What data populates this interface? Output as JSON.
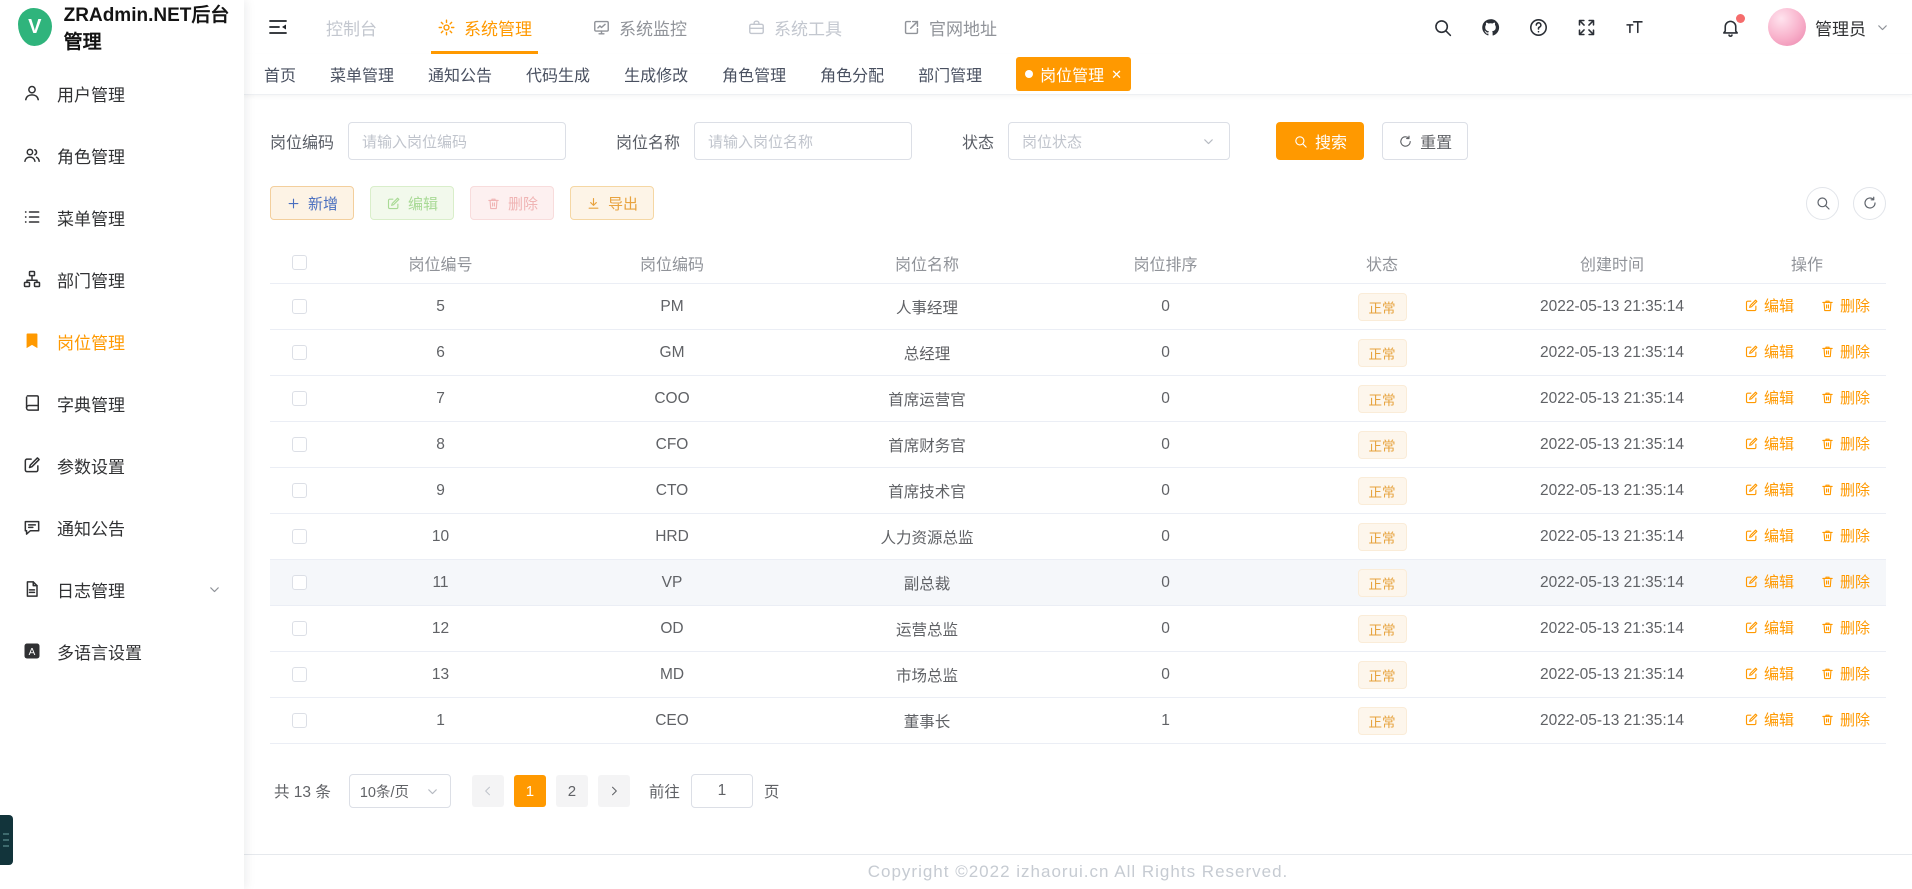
{
  "app": {
    "title": "ZRAdmin.NET后台管理",
    "logo_letter": "V"
  },
  "sidebar": {
    "items": [
      {
        "key": "user",
        "label": "用户管理",
        "icon": "user-icon"
      },
      {
        "key": "role",
        "label": "角色管理",
        "icon": "roles-icon"
      },
      {
        "key": "menu",
        "label": "菜单管理",
        "icon": "menu-list-icon"
      },
      {
        "key": "dept",
        "label": "部门管理",
        "icon": "org-tree-icon"
      },
      {
        "key": "post",
        "label": "岗位管理",
        "icon": "post-badge-icon",
        "active": true
      },
      {
        "key": "dict",
        "label": "字典管理",
        "icon": "dictionary-icon"
      },
      {
        "key": "param",
        "label": "参数设置",
        "icon": "edit-square-icon"
      },
      {
        "key": "notice",
        "label": "通知公告",
        "icon": "message-icon"
      },
      {
        "key": "log",
        "label": "日志管理",
        "icon": "document-icon",
        "arrow": true
      },
      {
        "key": "i18n",
        "label": "多语言设置",
        "icon": "language-icon"
      }
    ]
  },
  "topnav": {
    "items": [
      {
        "key": "console",
        "label": "控制台",
        "muted": true
      },
      {
        "key": "sysmanage",
        "label": "系统管理",
        "icon": "gear-icon",
        "active": true
      },
      {
        "key": "sysmonitor",
        "label": "系统监控",
        "icon": "monitor-icon"
      },
      {
        "key": "systools",
        "label": "系统工具",
        "icon": "toolbox-icon",
        "muted": true
      },
      {
        "key": "website",
        "label": "官网地址",
        "icon": "external-link-icon"
      }
    ],
    "user": {
      "name": "管理员"
    }
  },
  "tabs": {
    "items": [
      {
        "key": "home",
        "label": "首页"
      },
      {
        "key": "menu",
        "label": "菜单管理"
      },
      {
        "key": "notice",
        "label": "通知公告"
      },
      {
        "key": "codegen",
        "label": "代码生成"
      },
      {
        "key": "genedit",
        "label": "生成修改"
      },
      {
        "key": "role",
        "label": "角色管理"
      },
      {
        "key": "roleassign",
        "label": "角色分配"
      },
      {
        "key": "dept",
        "label": "部门管理"
      },
      {
        "key": "post",
        "label": "岗位管理",
        "active": true,
        "closable": true
      }
    ]
  },
  "filters": {
    "code": {
      "label": "岗位编码",
      "placeholder": "请输入岗位编码"
    },
    "name": {
      "label": "岗位名称",
      "placeholder": "请输入岗位名称"
    },
    "status": {
      "label": "状态",
      "placeholder": "岗位状态"
    },
    "search": "搜索",
    "reset": "重置"
  },
  "toolbar": {
    "add": "新增",
    "edit": "编辑",
    "delete": "删除",
    "export": "导出"
  },
  "table": {
    "columns": [
      "岗位编号",
      "岗位编码",
      "岗位名称",
      "岗位排序",
      "状态",
      "创建时间",
      "操作"
    ],
    "row_actions": {
      "edit": "编辑",
      "delete": "删除"
    },
    "rows": [
      {
        "id": "5",
        "code": "PM",
        "name": "人事经理",
        "sort": "0",
        "status": "正常",
        "created": "2022-05-13 21:35:14"
      },
      {
        "id": "6",
        "code": "GM",
        "name": "总经理",
        "sort": "0",
        "status": "正常",
        "created": "2022-05-13 21:35:14"
      },
      {
        "id": "7",
        "code": "COO",
        "name": "首席运营官",
        "sort": "0",
        "status": "正常",
        "created": "2022-05-13 21:35:14"
      },
      {
        "id": "8",
        "code": "CFO",
        "name": "首席财务官",
        "sort": "0",
        "status": "正常",
        "created": "2022-05-13 21:35:14"
      },
      {
        "id": "9",
        "code": "CTO",
        "name": "首席技术官",
        "sort": "0",
        "status": "正常",
        "created": "2022-05-13 21:35:14"
      },
      {
        "id": "10",
        "code": "HRD",
        "name": "人力资源总监",
        "sort": "0",
        "status": "正常",
        "created": "2022-05-13 21:35:14"
      },
      {
        "id": "11",
        "code": "VP",
        "name": "副总裁",
        "sort": "0",
        "status": "正常",
        "created": "2022-05-13 21:35:14",
        "hover": true
      },
      {
        "id": "12",
        "code": "OD",
        "name": "运营总监",
        "sort": "0",
        "status": "正常",
        "created": "2022-05-13 21:35:14"
      },
      {
        "id": "13",
        "code": "MD",
        "name": "市场总监",
        "sort": "0",
        "status": "正常",
        "created": "2022-05-13 21:35:14"
      },
      {
        "id": "1",
        "code": "CEO",
        "name": "董事长",
        "sort": "1",
        "status": "正常",
        "created": "2022-05-13 21:35:14"
      }
    ]
  },
  "pagination": {
    "total": "共 13 条",
    "page_size": "10条/页",
    "pages": [
      "1",
      "2"
    ],
    "active_page": "1",
    "goto_label": "前往",
    "goto_value": "1",
    "unit": "页"
  },
  "footer": {
    "copyright": "Copyright ©2022 izhaorui.cn All Rights Reserved."
  },
  "colors": {
    "accent": "#ff9900",
    "tag_text": "#e6a23c",
    "tag_bg": "#fdf6ec",
    "link": "#ff9900"
  }
}
